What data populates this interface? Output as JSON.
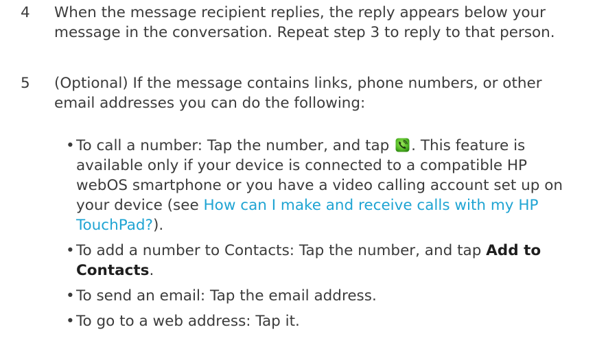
{
  "step4": {
    "number": "4",
    "line1": "When the message recipient replies, the reply appears below your",
    "line2": "message in the conversation. Repeat step 3 to reply to that person."
  },
  "step5": {
    "number": "5",
    "line1": "(Optional) If the message contains links, phone numbers, or other",
    "line2": "email addresses you can do the following:"
  },
  "bullet_symbol": "•",
  "bullet1": {
    "text_a": "To call a number: Tap the number, and tap ",
    "text_b": ". This feature is",
    "line2": "available only if your device is connected to a compatible HP",
    "line3": "webOS smartphone or you have a video calling account set up on",
    "line4_a": "your device (see ",
    "link_line1": "How can I make and receive calls with my HP",
    "link_line2": "TouchPad?",
    "tail": ").",
    "icon": "phone-call-icon",
    "icon_color": "#5cc12b"
  },
  "bullet2": {
    "text_a": "To add a number to Contacts: Tap the number, and tap ",
    "bold_1": "Add to",
    "bold_2": "Contacts",
    "tail": "."
  },
  "bullet3": {
    "text": "To send an email: Tap the email address."
  },
  "bullet4": {
    "text": "To go to a web address: Tap it."
  },
  "colors": {
    "body_text": "#3b3b3b",
    "link": "#1fa4d3",
    "bold_text": "#1e1e1e"
  }
}
